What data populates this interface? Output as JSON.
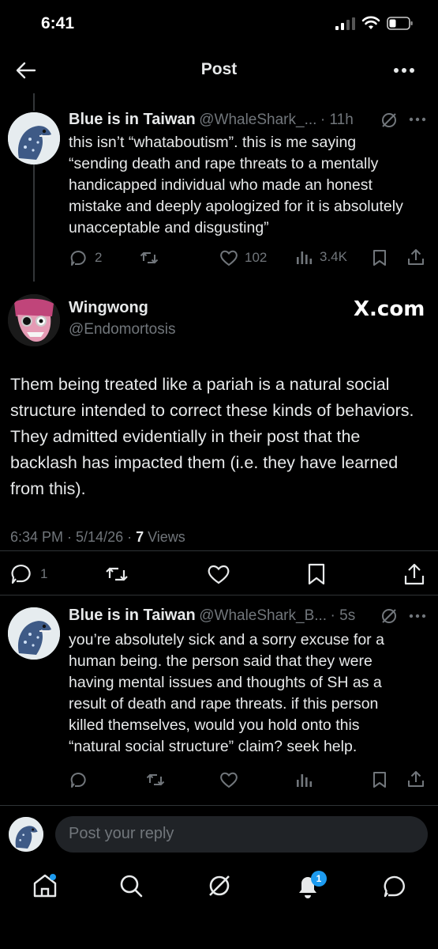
{
  "status_bar": {
    "time": "6:41"
  },
  "header": {
    "title": "Post"
  },
  "parent_tweet": {
    "name": "Blue is in Taiwan",
    "handle": "@WhaleShark_...",
    "time": "· 11h",
    "text": "this isn’t “whataboutism”. this is me saying “sending death and rape threats to a mentally handicapped individual who made an honest mistake and deeply apologized for it is absolutely unacceptable and disgusting”",
    "replies": "2",
    "likes": "102",
    "views": "3.4K"
  },
  "main_tweet": {
    "name": "Wingwong",
    "handle": "@Endomortosis",
    "brand": "X.com",
    "text": "Them being treated like a pariah is a natural social structure intended to correct these kinds of behaviors. They admitted evidentially in their post that the backlash has impacted them (i.e. they have learned from this).",
    "timestamp": "6:34 PM · 5/14/26 · ",
    "views_count": "7",
    "views_label": " Views",
    "replies": "1"
  },
  "reply_tweet": {
    "name": "Blue is in Taiwan",
    "handle": "@WhaleShark_B...",
    "time": "· 5s",
    "text": "you’re absolutely sick and a sorry excuse for a human being. the person said that they were having mental issues and thoughts of SH as a result of death and rape threats. if this person killed themselves, would you hold onto this “natural social structure” claim? seek help."
  },
  "composer": {
    "placeholder": "Post your reply"
  },
  "bottom_nav": {
    "notifications_badge": "1"
  },
  "colors": {
    "accent": "#1d9bf0",
    "muted": "#71767b",
    "text": "#e7e9ea",
    "background": "#000000"
  }
}
